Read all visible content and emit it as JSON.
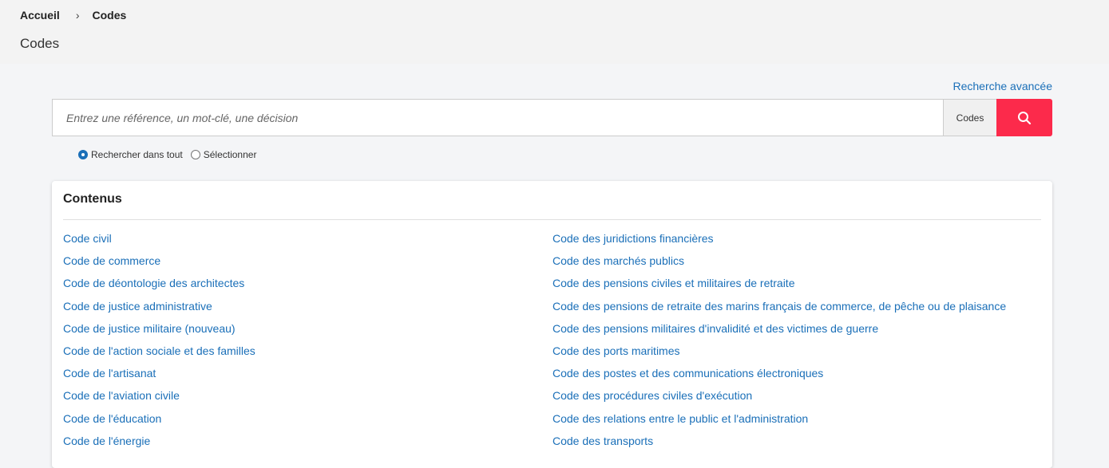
{
  "breadcrumb": {
    "home": "Accueil",
    "separator": "›",
    "current": "Codes"
  },
  "page_title": "Codes",
  "advanced_search_label": "Recherche avancée",
  "search": {
    "placeholder": "Entrez une référence, un mot-clé, une décision",
    "value": "",
    "scope": "Codes"
  },
  "radios": {
    "all_label": "Rechercher dans tout",
    "select_label": "Sélectionner",
    "selected": "all"
  },
  "panel": {
    "title": "Contenus",
    "left_items": [
      "Code civil",
      "Code de commerce",
      "Code de déontologie des architectes",
      "Code de justice administrative",
      "Code de justice militaire (nouveau)",
      "Code de l'action sociale et des familles",
      "Code de l'artisanat",
      "Code de l'aviation civile",
      "Code de l'éducation",
      "Code de l'énergie"
    ],
    "right_items": [
      "Code des juridictions financières",
      "Code des marchés publics",
      "Code des pensions civiles et militaires de retraite",
      "Code des pensions de retraite des marins français de commerce, de pêche ou de plaisance",
      "Code des pensions militaires d'invalidité et des victimes de guerre",
      "Code des ports maritimes",
      "Code des postes et des communications électroniques",
      "Code des procédures civiles d'exécution",
      "Code des relations entre le public et l'administration",
      "Code des transports"
    ]
  },
  "colors": {
    "accent": "#fc2a4b",
    "link": "#1a6fb8"
  },
  "icons": {
    "search_button": "search-icon",
    "radio_checked": "radio-checked-icon"
  }
}
